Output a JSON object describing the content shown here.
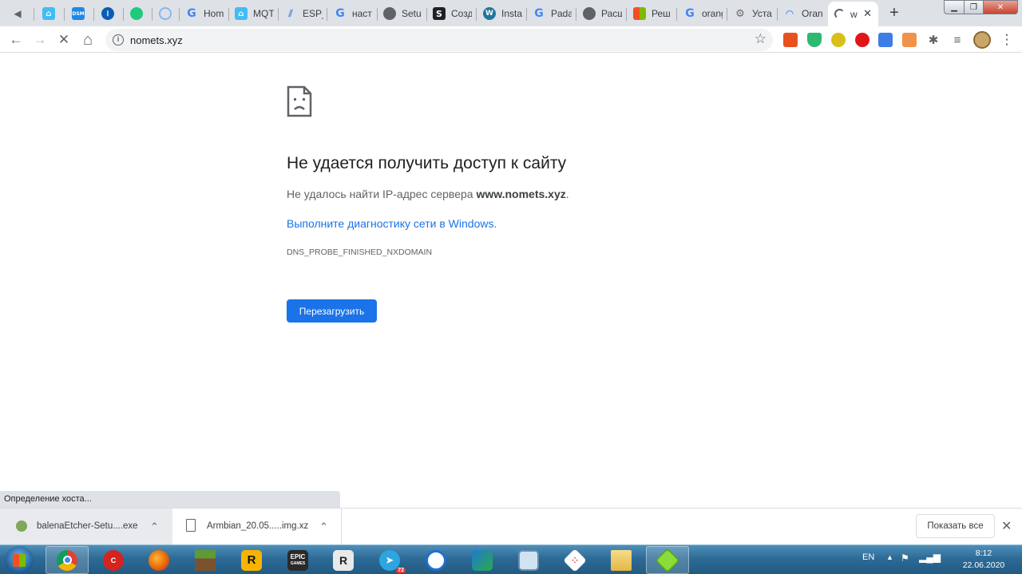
{
  "tabs": [
    {
      "title": "",
      "icon": "speaker-icon",
      "color": "#5f6368"
    },
    {
      "title": "",
      "icon": "home-assistant-icon",
      "color": "#41bdf5"
    },
    {
      "title": "",
      "icon": "dsm-icon",
      "color": "#1e88e5"
    },
    {
      "title": "",
      "icon": "onepassword-icon",
      "color": "#0a5db5"
    },
    {
      "title": "",
      "icon": "green-cloud-icon",
      "color": "#1ecb7b"
    },
    {
      "title": "",
      "icon": "cloud-outline-icon",
      "color": "#8ab4f8"
    },
    {
      "title": "Hom",
      "icon": "google-icon",
      "color": "#4285f4"
    },
    {
      "title": "MQT",
      "icon": "home-assistant-icon",
      "color": "#41bdf5"
    },
    {
      "title": "ESP_",
      "icon": "stripes-icon",
      "color": "#5b8bd6"
    },
    {
      "title": "наст",
      "icon": "google-icon",
      "color": "#4285f4"
    },
    {
      "title": "Setu",
      "icon": "globe-icon",
      "color": "#5f6368"
    },
    {
      "title": "Созд",
      "icon": "s-icon",
      "color": "#202124"
    },
    {
      "title": "Insta",
      "icon": "wordpress-icon",
      "color": "#21759b"
    },
    {
      "title": "Pada",
      "icon": "google-icon",
      "color": "#4285f4"
    },
    {
      "title": "Расш",
      "icon": "globe-icon",
      "color": "#5f6368"
    },
    {
      "title": "Реш",
      "icon": "microsoft-icon",
      "color": "#f25022"
    },
    {
      "title": "orang",
      "icon": "google-icon",
      "color": "#4285f4"
    },
    {
      "title": "Уста",
      "icon": "gear-icon",
      "color": "#6b6b6b"
    },
    {
      "title": "Oran",
      "icon": "wifi-icon",
      "color": "#1a73e8"
    },
    {
      "title": "w",
      "icon": "loading-spinner-icon",
      "color": "#5f6368",
      "active": true
    }
  ],
  "tab_google_letter": "G",
  "tab_s_letter": "S",
  "tab_dsm_letter": "DSM",
  "tab_close": "✕",
  "new_tab": "+",
  "window_controls": {
    "minimize": "▁",
    "maximize": "❐",
    "close": "✕"
  },
  "address": {
    "url": "nomets.xyz",
    "info": "i"
  },
  "toolbar_glyphs": {
    "back": "←",
    "forward": "→",
    "stop": "✕",
    "home": "⌂",
    "star": "☆",
    "menu": "⋮"
  },
  "extensions": [
    "gift-extension-icon",
    "shield-extension-icon",
    "yellow-extension-icon",
    "opera-extension-icon",
    "translate-extension-icon",
    "badge-extension-icon",
    "puzzle-extension-icon",
    "playlist-extension-icon",
    "profile-avatar-icon"
  ],
  "error": {
    "title": "Не удается получить доступ к сайту",
    "text_prefix": "Не удалось найти IP-адрес сервера ",
    "host": "www.nomets.xyz",
    "text_suffix": ".",
    "link": "Выполните диагностику сети в Windows.",
    "code": "DNS_PROBE_FINISHED_NXDOMAIN",
    "reload": "Перезагрузить"
  },
  "status_text": "Определение хоста...",
  "downloads": [
    {
      "name": "balenaEtcher-Setu....exe",
      "icon": "etcher-icon"
    },
    {
      "name": "Armbian_20.05.....img.xz",
      "icon": "file-icon"
    }
  ],
  "show_all": "Показать все",
  "shelf_close": "✕",
  "chevron": "⌃",
  "taskbar": {
    "apps": [
      "chrome-icon",
      "ccleaner-icon",
      "firefox-icon",
      "minecraft-icon",
      "rockstar-icon",
      "epic-games-icon",
      "app-r-icon",
      "telegram-icon",
      "network-app-icon",
      "vpn-lock-icon",
      "magnifier-app-icon",
      "dice-app-icon",
      "folder-icon",
      "green-cube-icon"
    ],
    "epic_label": "EPIC",
    "epic_sub": "GAMES",
    "rockstar_label": "R",
    "r_label": "R",
    "telegram_badge": "72",
    "language": "EN",
    "time": "8:12",
    "date": "22.06.2020"
  }
}
